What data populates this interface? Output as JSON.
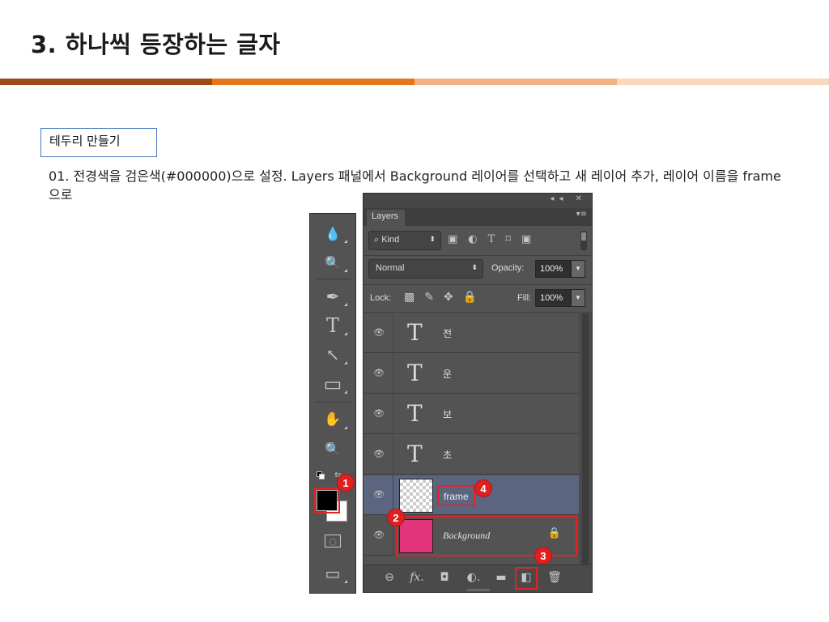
{
  "slide": {
    "title": "3. 하나씩 등장하는 글자",
    "section_box": "테두리 만들기",
    "instruction": "01. 전경색을 검은색(#000000)으로 설정. Layers 패널에서 Background 레이어를 선택하고 새 레이어 추가, 레이어 이름을 frame으로"
  },
  "colors": {
    "stripe_dark": "#9c4a16",
    "stripe_orange": "#e3761a",
    "stripe_light": "#f3b283",
    "stripe_pale": "#f9d7bd",
    "annotation_red": "#e22424",
    "foreground": "#000000",
    "background": "#ffffff",
    "bg_layer_fill": "#e3357b"
  },
  "tools_panel": {
    "tools": [
      {
        "icon": "blur-drop-icon",
        "glyph": "💧"
      },
      {
        "icon": "dodge-icon",
        "glyph": "🔍"
      },
      {
        "icon": "pen-tool-icon",
        "glyph": "✒"
      },
      {
        "icon": "type-tool-icon",
        "glyph": "T"
      },
      {
        "icon": "path-selection-icon",
        "glyph": "↖"
      },
      {
        "icon": "rectangle-tool-icon",
        "glyph": "▭"
      },
      {
        "icon": "hand-tool-icon",
        "glyph": "✋"
      },
      {
        "icon": "zoom-tool-icon",
        "glyph": "🔍"
      }
    ],
    "quick_mask_glyph": "◌",
    "screen_mode_glyph": "▭"
  },
  "layers_panel": {
    "collapse_controls": "◂◂ ✕",
    "tab_label": "Layers",
    "menu_glyph": "▾≡",
    "filter": {
      "icon": "search-icon",
      "label": "Kind",
      "arrow": "⬍"
    },
    "filter_icons": [
      "▣",
      "◐",
      "T",
      "⌑",
      "▣"
    ],
    "blend_mode": "Normal",
    "blend_arrow": "⬍",
    "opacity_label": "Opacity:",
    "opacity_value": "100%",
    "lock_label": "Lock:",
    "lock_icons": [
      "▩",
      "✎",
      "✥",
      "🔒"
    ],
    "fill_label": "Fill:",
    "fill_value": "100%",
    "dropdown_arrow": "▾",
    "eye_glyph": "👁",
    "text_layer_glyph": "T",
    "layers": [
      {
        "name": "전",
        "kind": "text"
      },
      {
        "name": "운",
        "kind": "text"
      },
      {
        "name": "보",
        "kind": "text"
      },
      {
        "name": "초",
        "kind": "text"
      },
      {
        "name": "frame",
        "kind": "pixel",
        "selected": true
      },
      {
        "name": "Background",
        "kind": "background",
        "locked": true
      }
    ],
    "lock_glyph": "🔒",
    "footer_icons": [
      "⊖",
      "fx.",
      "◘",
      "◐.",
      "▬",
      "◧",
      "🗑"
    ]
  },
  "annotations": [
    "1",
    "2",
    "3",
    "4"
  ]
}
